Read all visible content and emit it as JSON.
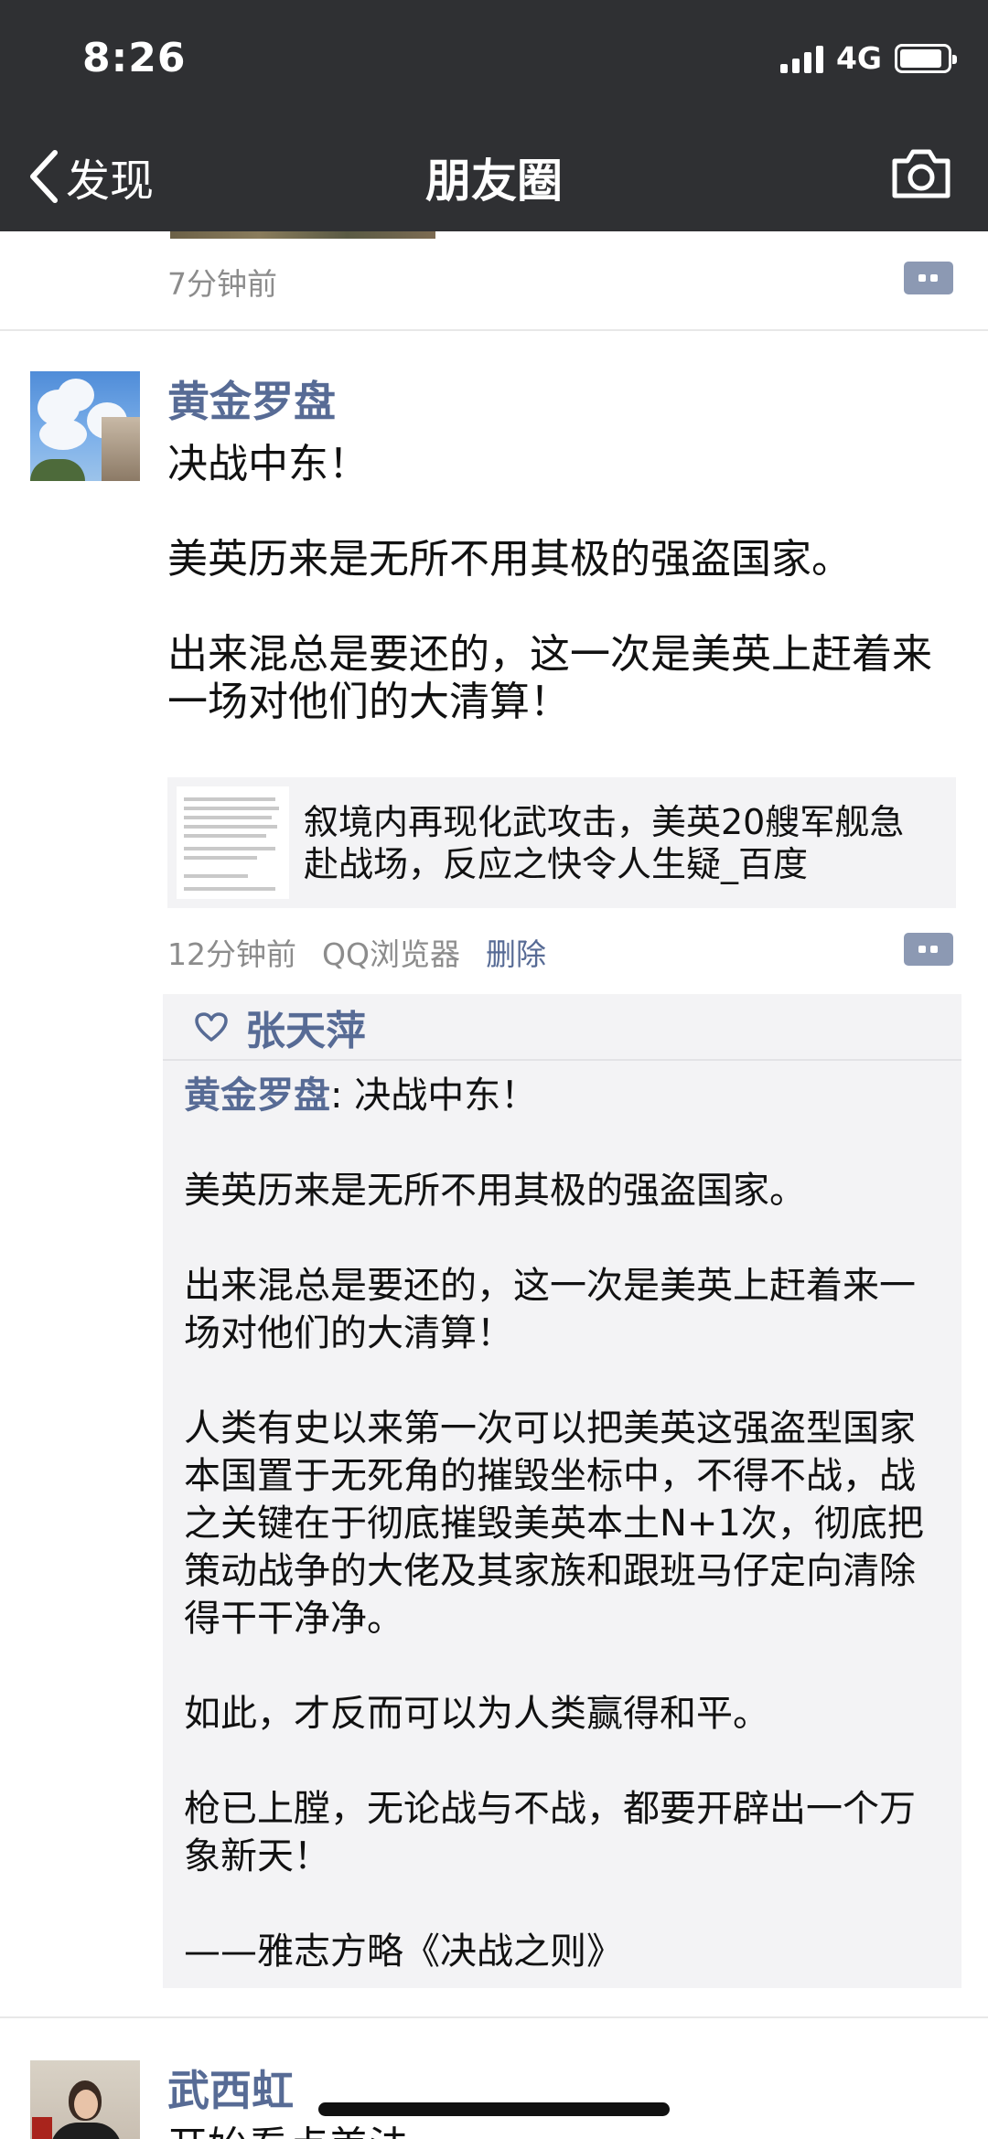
{
  "status_bar": {
    "time": "8:26",
    "network": "4G",
    "battery_level": 0.9
  },
  "nav": {
    "back_label": "发现",
    "title": "朋友圈",
    "icons": [
      "chevron-left-icon",
      "camera-icon"
    ]
  },
  "prev_post": {
    "time": "7分钟前"
  },
  "post": {
    "username": "黄金罗盘",
    "lines": [
      "决战中东！",
      "",
      "美英历来是无所不用其极的强盗国家。",
      "",
      "出来混总是要还的，这一次是美英上赶着来一场对他们的大清算！"
    ],
    "link": {
      "title": "叙境内再现化武攻击，美英20艘军舰急赴战场，反应之快令人生疑_百度"
    },
    "time": "12分钟前",
    "source": "QQ浏览器",
    "delete_label": "删除",
    "like_name": "张天萍",
    "comment": {
      "author": "黄金罗盘",
      "separator": ": ",
      "first_line": "决战中东！",
      "lines": [
        "",
        "美英历来是无所不用其极的强盗国家。",
        "",
        "出来混总是要还的，这一次是美英上赶着来一场对他们的大清算！",
        "",
        "人类有史以来第一次可以把美英这强盗型国家本国置于无死角的摧毁坐标中，不得不战，战之关键在于彻底摧毁美英本土N+1次，彻底把策动战争的大佬及其家族和跟班马仔定向清除得干干净净。",
        "",
        "如此，才反而可以为人类赢得和平。",
        "",
        "枪已上膛，无论战与不战，都要开辟出一个万象新天！",
        "",
        "——雅志方略《决战之则》"
      ]
    }
  },
  "next_post": {
    "username": "武西虹",
    "first_line_partial": "开始看点美法"
  },
  "colors": {
    "link_blue": "#576b95",
    "nav_bg": "#2f3033",
    "meta_gray": "#8c8c8c",
    "comment_bg": "#f3f3f5"
  }
}
